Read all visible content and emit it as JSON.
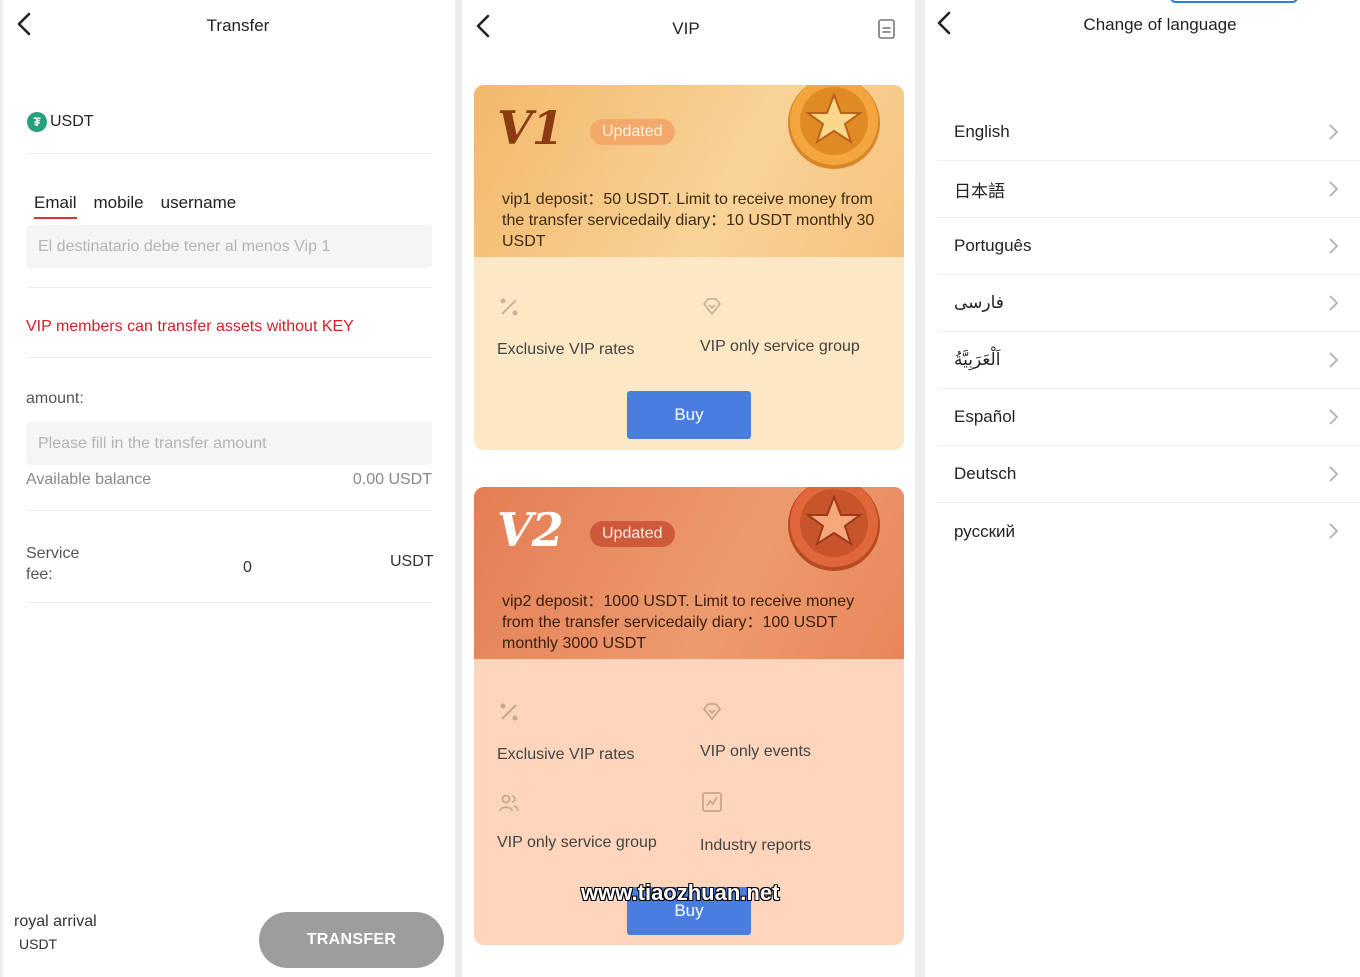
{
  "transfer": {
    "title": "Transfer",
    "currency": "USDT",
    "tabs": [
      {
        "label": "Email",
        "active": true
      },
      {
        "label": "mobile",
        "active": false
      },
      {
        "label": "username",
        "active": false
      }
    ],
    "recipient_placeholder": "El destinatario debe tener al menos Vip 1",
    "vip_note": "VIP members can transfer assets without KEY",
    "amount_label": "amount:",
    "amount_placeholder": "Please fill in the transfer amount",
    "balance_label": "Available balance",
    "balance_value": "0.00 USDT",
    "fee_label": "Service fee:",
    "fee_value": "0",
    "fee_unit": "USDT",
    "footer_name": "royal arrival",
    "footer_unit": "USDT",
    "submit_label": "TRANSFER",
    "colors": {
      "accent_red": "#d21f26",
      "button_disabled": "#9d9d9d",
      "usdt": "#26a17b"
    }
  },
  "vip": {
    "title": "VIP",
    "cards": [
      {
        "level": "V1",
        "badge": "Updated",
        "description": "vip1 deposit：50 USDT. Limit to receive money from the transfer servicedaily diary：10 USDT monthly 30 USDT",
        "features": [
          "Exclusive VIP rates",
          "VIP only service group"
        ],
        "buy_label": "Buy"
      },
      {
        "level": "V2",
        "badge": "Updated",
        "description": "vip2 deposit：1000 USDT. Limit to receive money from the transfer servicedaily diary：100 USDT monthly 3000 USDT",
        "features": [
          "Exclusive VIP rates",
          "VIP only events",
          "VIP only service group",
          "Industry reports"
        ],
        "buy_label": "Buy"
      }
    ],
    "watermark": "www.tiaozhuan.net",
    "colors": {
      "buy_button": "#4a7de0",
      "v1_card": "#fde8c6",
      "v2_card": "#fdd5bd"
    }
  },
  "language": {
    "title": "Change of language",
    "items": [
      "English",
      "日本語",
      "Português",
      "فارسی",
      "اَلْعَرَبِيَّةُ",
      "Español",
      "Deutsch",
      "русский"
    ]
  }
}
